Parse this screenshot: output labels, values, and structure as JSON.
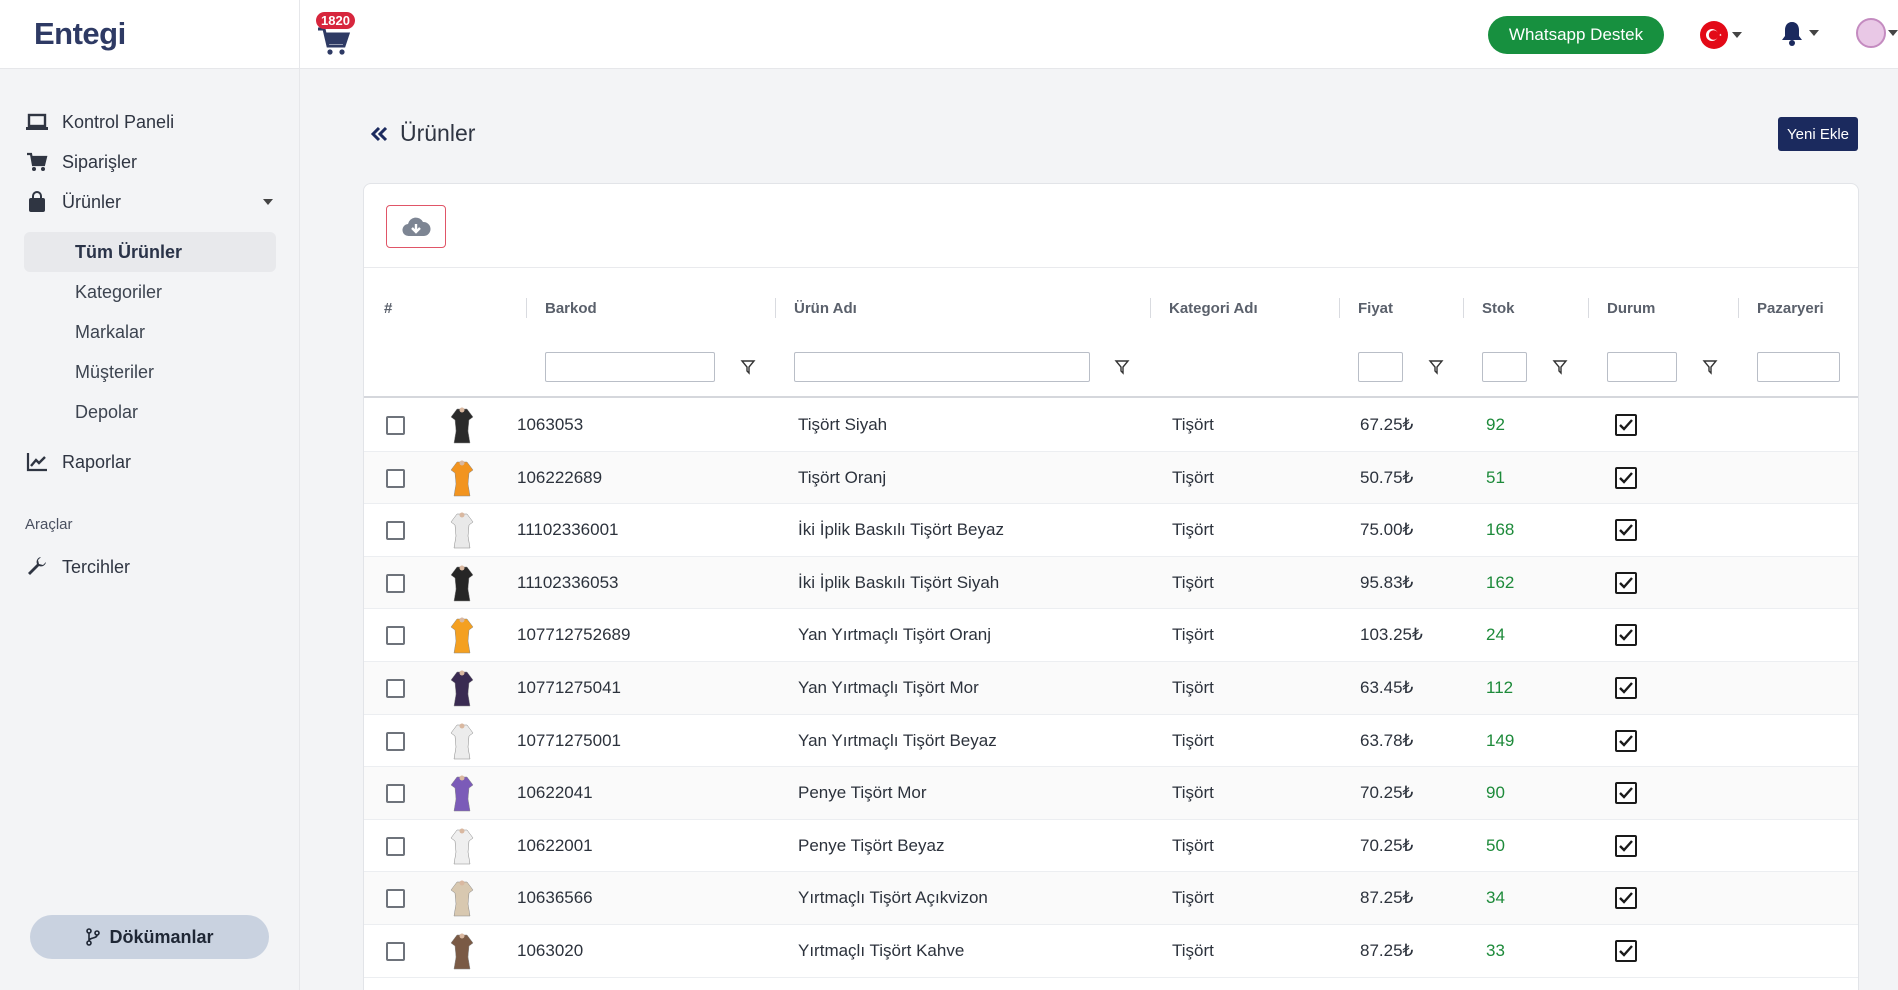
{
  "topbar": {
    "logo": "Entegi",
    "cart_count": "1820",
    "whatsapp_label": "Whatsapp Destek"
  },
  "sidebar": {
    "items": [
      {
        "label": "Kontrol Paneli",
        "icon": "laptop-icon"
      },
      {
        "label": "Siparişler",
        "icon": "cart-icon"
      },
      {
        "label": "Ürünler",
        "icon": "bag-icon"
      }
    ],
    "sub_items": [
      "Tüm Ürünler",
      "Kategoriler",
      "Markalar",
      "Müşteriler",
      "Depolar"
    ],
    "reports_label": "Raporlar",
    "tools_section": "Araçlar",
    "preferences_label": "Tercihler",
    "docs_label": "Dökümanlar"
  },
  "page": {
    "title": "Ürünler",
    "new_button": "Yeni Ekle"
  },
  "table": {
    "headers": {
      "index": "#",
      "barcode": "Barkod",
      "name": "Ürün Adı",
      "category": "Kategori Adı",
      "price": "Fiyat",
      "stock": "Stok",
      "status": "Durum",
      "marketplace": "Pazaryeri"
    },
    "rows": [
      {
        "barcode": "1063053",
        "name": "Tişört Siyah",
        "category": "Tişört",
        "price": "67.25₺",
        "stock": "92",
        "thumb_color": "#2b2b2b"
      },
      {
        "barcode": "106222689",
        "name": "Tişört Oranj",
        "category": "Tişört",
        "price": "50.75₺",
        "stock": "51",
        "thumb_color": "#f2941f"
      },
      {
        "barcode": "11102336001",
        "name": "İki İplik Baskılı Tişört Beyaz",
        "category": "Tişört",
        "price": "75.00₺",
        "stock": "168",
        "thumb_color": "#e9e9e9"
      },
      {
        "barcode": "11102336053",
        "name": "İki İplik Baskılı Tişört Siyah",
        "category": "Tişört",
        "price": "95.83₺",
        "stock": "162",
        "thumb_color": "#262626"
      },
      {
        "barcode": "107712752689",
        "name": "Yan Yırtmaçlı Tişört Oranj",
        "category": "Tişört",
        "price": "103.25₺",
        "stock": "24",
        "thumb_color": "#f4a021"
      },
      {
        "barcode": "10771275041",
        "name": "Yan Yırtmaçlı Tişört Mor",
        "category": "Tişört",
        "price": "63.45₺",
        "stock": "112",
        "thumb_color": "#3a2b52"
      },
      {
        "barcode": "10771275001",
        "name": "Yan Yırtmaçlı Tişört Beyaz",
        "category": "Tişört",
        "price": "63.78₺",
        "stock": "149",
        "thumb_color": "#ececec"
      },
      {
        "barcode": "10622041",
        "name": "Penye Tişört Mor",
        "category": "Tişört",
        "price": "70.25₺",
        "stock": "90",
        "thumb_color": "#7b5bb8"
      },
      {
        "barcode": "10622001",
        "name": "Penye Tişört Beyaz",
        "category": "Tişört",
        "price": "70.25₺",
        "stock": "50",
        "thumb_color": "#efefef"
      },
      {
        "barcode": "10636566",
        "name": "Yırtmaçlı Tişört Açıkvizon",
        "category": "Tişört",
        "price": "87.25₺",
        "stock": "34",
        "thumb_color": "#d8c8b0"
      },
      {
        "barcode": "1063020",
        "name": "Yırtmaçlı Tişört Kahve",
        "category": "Tişört",
        "price": "87.25₺",
        "stock": "33",
        "thumb_color": "#7a5a45"
      }
    ]
  },
  "colors": {
    "brand": "#2e3a64",
    "accent": "#1b2a5e",
    "whatsapp": "#17903f",
    "stock_green": "#1d8a3a",
    "badge_red": "#d7263d"
  }
}
